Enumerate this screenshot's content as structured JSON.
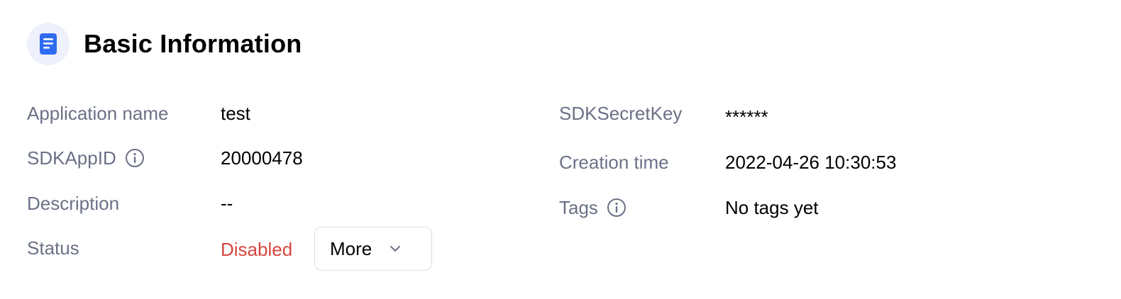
{
  "header": {
    "title": "Basic Information",
    "icon": "document-icon",
    "icon_color": "#2f6bf0"
  },
  "left_fields": {
    "app_name": {
      "label": "Application name",
      "value": "test"
    },
    "sdk_app_id": {
      "label": "SDKAppID",
      "value": "20000478"
    },
    "description": {
      "label": "Description",
      "value": "--"
    },
    "status": {
      "label": "Status",
      "value": "Disabled",
      "value_color": "#d6453f"
    }
  },
  "right_fields": {
    "sdk_secret_key": {
      "label": "SDKSecretKey",
      "value": "******"
    },
    "creation_time": {
      "label": "Creation time",
      "value": "2022-04-26 10:30:53"
    },
    "tags": {
      "label": "Tags",
      "value": "No tags yet"
    }
  },
  "more_button": {
    "label": "More"
  }
}
